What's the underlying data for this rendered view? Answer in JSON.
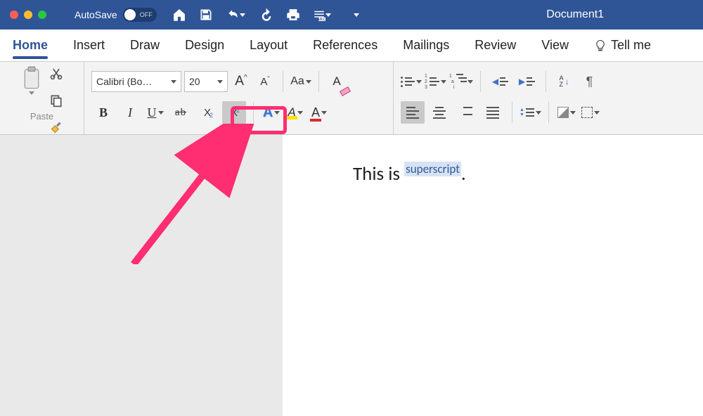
{
  "titlebar": {
    "autosave_label": "AutoSave",
    "autosave_state": "OFF",
    "document_title": "Document1"
  },
  "tabs": {
    "home": "Home",
    "insert": "Insert",
    "draw": "Draw",
    "design": "Design",
    "layout": "Layout",
    "references": "References",
    "mailings": "Mailings",
    "review": "Review",
    "view": "View",
    "tellme": "Tell me"
  },
  "ribbon": {
    "paste_label": "Paste",
    "font_name": "Calibri (Bo…",
    "font_size": "20",
    "grow_font": "A",
    "shrink_font": "A",
    "change_case": "Aa",
    "text_effects": "A",
    "highlight": "A",
    "font_color": "A",
    "bold": "B",
    "italic": "I",
    "underline": "U",
    "strike": "ab",
    "subscript_base": "X",
    "subscript_mini": "2",
    "superscript_base": "X",
    "superscript_mini": "2",
    "sort_a": "A",
    "sort_z": "Z",
    "pilcrow": "¶"
  },
  "document": {
    "line_prefix": "This is ",
    "superscript_text": "superscript",
    "line_suffix": "."
  },
  "annotation": {
    "highlight_target": "subscript-superscript-buttons"
  }
}
